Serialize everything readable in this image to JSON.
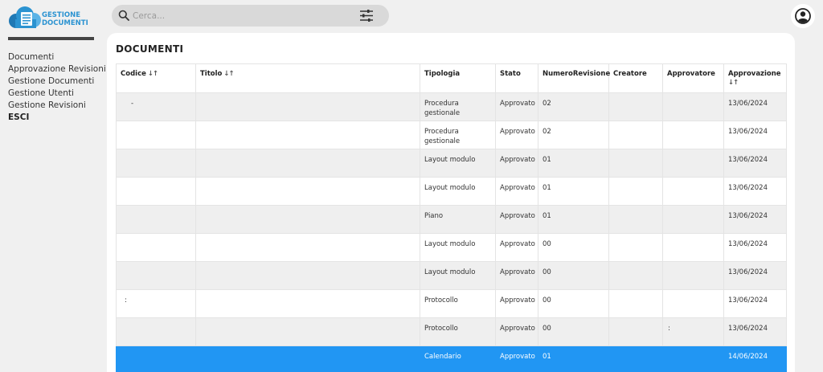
{
  "app": {
    "logo_line1": "GESTIONE",
    "logo_line2": "DOCUMENTI",
    "brand_color": "#2b93d1"
  },
  "sidebar": {
    "items": [
      {
        "label": "Documenti"
      },
      {
        "label": "Approvazione Revisioni"
      },
      {
        "label": "Gestione Documenti"
      },
      {
        "label": "Gestione Utenti"
      },
      {
        "label": "Gestione Revisioni"
      },
      {
        "label": "ESCI"
      }
    ]
  },
  "search": {
    "placeholder": "Cerca...",
    "value": ""
  },
  "main": {
    "title": "DOCUMENTI",
    "sort_glyph": "↓↑",
    "columns": [
      "Codice",
      "Titolo",
      "Tipologia",
      "Stato",
      "NumeroRevisione",
      "Creatore",
      "Approvatore",
      "Approvazione"
    ],
    "rows": [
      {
        "codice": "-",
        "titolo": "",
        "tipologia": "Procedura gestionale",
        "stato": "Approvato",
        "revisione": "02",
        "creatore": "",
        "approvatore": "",
        "approvazione": "13/06/2024"
      },
      {
        "codice": "",
        "titolo": "",
        "tipologia": "Procedura gestionale",
        "stato": "Approvato",
        "revisione": "02",
        "creatore": "",
        "approvatore": "",
        "approvazione": "13/06/2024"
      },
      {
        "codice": "",
        "titolo": "",
        "tipologia": "Layout modulo",
        "stato": "Approvato",
        "revisione": "01",
        "creatore": "",
        "approvatore": "",
        "approvazione": "13/06/2024"
      },
      {
        "codice": "",
        "titolo": "",
        "tipologia": "Layout modulo",
        "stato": "Approvato",
        "revisione": "01",
        "creatore": "",
        "approvatore": "",
        "approvazione": "13/06/2024"
      },
      {
        "codice": "",
        "titolo": "",
        "tipologia": "Piano",
        "stato": "Approvato",
        "revisione": "01",
        "creatore": "",
        "approvatore": "",
        "approvazione": "13/06/2024"
      },
      {
        "codice": "",
        "titolo": "",
        "tipologia": "Layout modulo",
        "stato": "Approvato",
        "revisione": "00",
        "creatore": "",
        "approvatore": "",
        "approvazione": "13/06/2024"
      },
      {
        "codice": "",
        "titolo": "",
        "tipologia": "Layout modulo",
        "stato": "Approvato",
        "revisione": "00",
        "creatore": "",
        "approvatore": "",
        "approvazione": "13/06/2024"
      },
      {
        "codice": ":",
        "titolo": "",
        "tipologia": "Protocollo",
        "stato": "Approvato",
        "revisione": "00",
        "creatore": "",
        "approvatore": "",
        "approvazione": "13/06/2024"
      },
      {
        "codice": "",
        "titolo": "",
        "tipologia": "Protocollo",
        "stato": "Approvato",
        "revisione": "00",
        "creatore": "",
        "approvatore": ":",
        "approvazione": "13/06/2024"
      },
      {
        "codice": "",
        "titolo": "",
        "tipologia": "Calendario",
        "stato": "Approvato",
        "revisione": "01",
        "creatore": "",
        "approvatore": "",
        "approvazione": "14/06/2024",
        "selected": true
      }
    ],
    "selected_color": "#2196f3"
  },
  "icons": {
    "search": "search-icon",
    "filter": "sliders-icon",
    "user": "user-circle-icon",
    "logo": "cloud-document-icon"
  }
}
